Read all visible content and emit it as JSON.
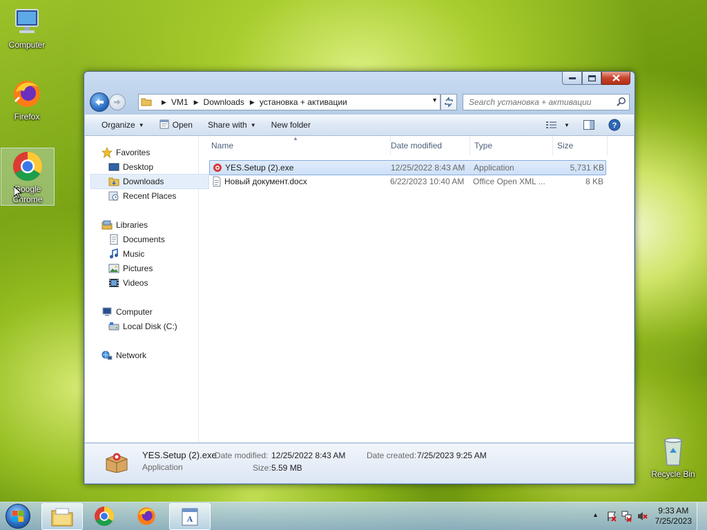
{
  "desktop": {
    "icons": [
      {
        "label": "Computer"
      },
      {
        "label": "Firefox"
      },
      {
        "label": "Google Chrome"
      },
      {
        "label": "Recycle Bin"
      }
    ]
  },
  "window": {
    "address": {
      "crumbs": [
        "VM1",
        "Downloads",
        "установка + активации"
      ]
    },
    "search": {
      "placeholder": "Search установка + активации"
    },
    "toolbar": {
      "organize": "Organize",
      "open": "Open",
      "share_with": "Share with",
      "new_folder": "New folder"
    },
    "nav": {
      "favorites": "Favorites",
      "desktop": "Desktop",
      "downloads": "Downloads",
      "recent_places": "Recent Places",
      "libraries": "Libraries",
      "documents": "Documents",
      "music": "Music",
      "pictures": "Pictures",
      "videos": "Videos",
      "computer": "Computer",
      "local_disk": "Local Disk (C:)",
      "network": "Network"
    },
    "columns": {
      "name": "Name",
      "date_modified": "Date modified",
      "type": "Type",
      "size": "Size"
    },
    "files": [
      {
        "name": "YES.Setup (2).exe",
        "date": "12/25/2022 8:43 AM",
        "type": "Application",
        "size": "5,731 KB"
      },
      {
        "name": "Новый документ.docx",
        "date": "6/22/2023 10:40 AM",
        "type": "Office Open XML ...",
        "size": "8 KB"
      }
    ],
    "details": {
      "name": "YES.Setup (2).exe",
      "kind": "Application",
      "date_modified_label": "Date modified:",
      "date_modified": "12/25/2022 8:43 AM",
      "size_label": "Size:",
      "size": "5.59 MB",
      "date_created_label": "Date created:",
      "date_created": "7/25/2023 9:25 AM"
    }
  },
  "taskbar": {
    "time": "9:33 AM",
    "date": "7/25/2023"
  },
  "colors": {
    "accent": "#2b6ec4",
    "selection": "#cde0f8"
  }
}
